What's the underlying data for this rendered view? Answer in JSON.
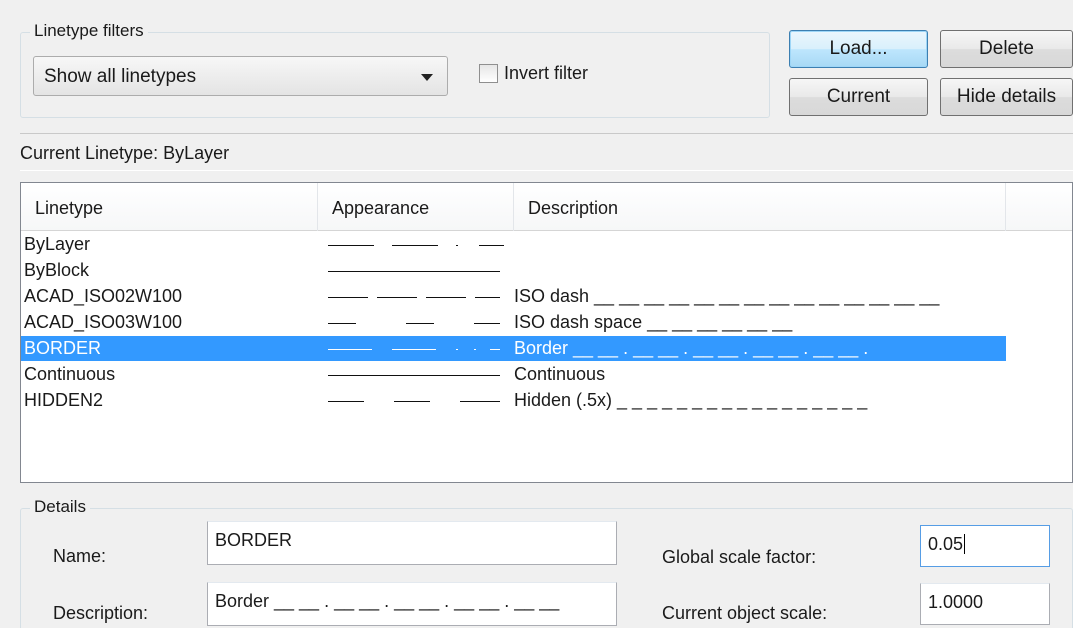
{
  "filters": {
    "group_title": "Linetype filters",
    "selected": "Show all linetypes",
    "invert_label": "Invert filter",
    "invert_checked": false
  },
  "buttons": {
    "load": "Load...",
    "delete": "Delete",
    "current": "Current",
    "hide_details": "Hide details"
  },
  "current_linetype": "Current Linetype:  ByLayer",
  "table": {
    "columns": [
      "Linetype",
      "Appearance",
      "Description"
    ],
    "rows": [
      {
        "name": "ByLayer",
        "description": "",
        "pattern": "bylayer",
        "selected": false
      },
      {
        "name": "ByBlock",
        "description": "",
        "pattern": "continuous",
        "selected": false
      },
      {
        "name": "ACAD_ISO02W100",
        "description": "ISO dash __ __ __ __ __ __ __ __ __ __ __ __ __ __",
        "pattern": "iso02",
        "selected": false
      },
      {
        "name": "ACAD_ISO03W100",
        "description": "ISO dash space __    __    __    __    __    __",
        "pattern": "iso03",
        "selected": false
      },
      {
        "name": "BORDER",
        "description": "Border __ __ . __ __ . __ __ . __ __ . __ __ .",
        "pattern": "border",
        "selected": true
      },
      {
        "name": "Continuous",
        "description": "Continuous",
        "pattern": "continuous",
        "selected": false
      },
      {
        "name": "HIDDEN2",
        "description": "Hidden (.5x) _ _ _ _ _ _ _ _ _ _ _ _ _ _ _ _ _",
        "pattern": "hidden",
        "selected": false
      }
    ]
  },
  "details": {
    "group_title": "Details",
    "name_label": "Name:",
    "name_value": "BORDER",
    "description_label": "Description:",
    "description_value": "Border __ __ . __ __ . __ __ . __ __ . __ __",
    "global_scale_label": "Global scale factor:",
    "global_scale_value": "0.05",
    "object_scale_label": "Current object scale:",
    "object_scale_value": "1.0000"
  },
  "colors": {
    "selection": "#3399ff",
    "focus_border": "#3c7fb1"
  }
}
